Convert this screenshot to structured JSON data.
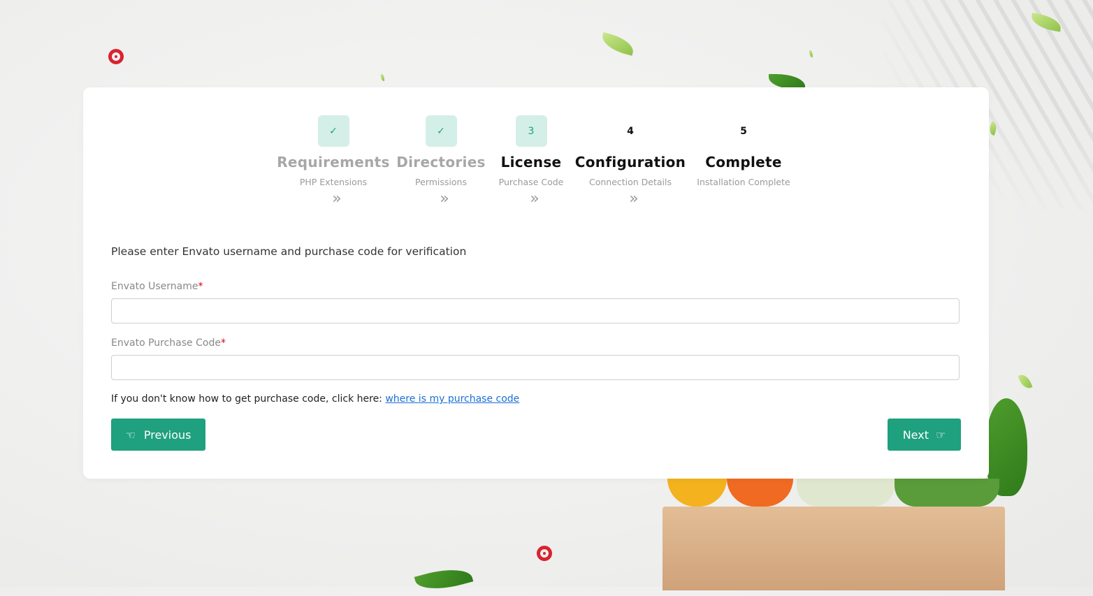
{
  "steps": [
    {
      "badge": "✓",
      "title": "Requirements",
      "subtitle": "PHP Extensions",
      "state": "done"
    },
    {
      "badge": "✓",
      "title": "Directories",
      "subtitle": "Permissions",
      "state": "done"
    },
    {
      "badge": "3",
      "title": "License",
      "subtitle": "Purchase Code",
      "state": "active"
    },
    {
      "badge": "4",
      "title": "Configuration",
      "subtitle": "Connection Details",
      "state": "pending"
    },
    {
      "badge": "5",
      "title": "Complete",
      "subtitle": "Installation Complete",
      "state": "pending"
    }
  ],
  "step_arrow": "»",
  "form": {
    "intro": "Please enter Envato username and purchase code for verification",
    "username_label": "Envato Username",
    "purchase_code_label": "Envato Purchase Code",
    "required_mark": "*",
    "username_value": "",
    "purchase_code_value": "",
    "help_text": "If you don't know how to get purchase code, click here: ",
    "help_link": "where is my purchase code"
  },
  "buttons": {
    "previous_label": "Previous",
    "next_label": "Next",
    "previous_icon": "hand-pointing-left-icon",
    "next_icon": "hand-pointing-right-icon"
  },
  "colors": {
    "accent": "#1fa07e",
    "badge_bg": "#d4efe7",
    "link": "#1a6fd6",
    "required": "#d0021b"
  }
}
